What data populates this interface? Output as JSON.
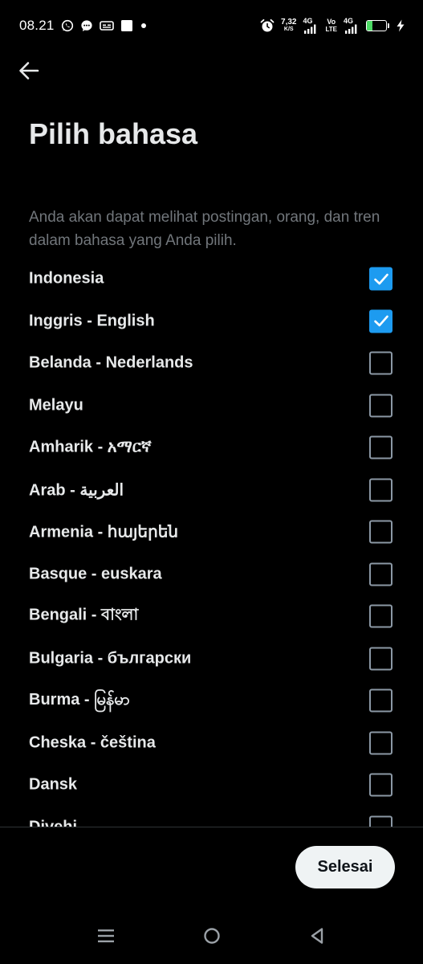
{
  "status_bar": {
    "time": "08.21",
    "net_speed_value": "7,32",
    "net_speed_unit": "K/S",
    "sim1_label": "4G",
    "volte_top": "Vo",
    "volte_bottom": "LTE",
    "sim2_label": "4G",
    "battery_level": "31",
    "left_icons": [
      "whatsapp-icon",
      "messenger-icon",
      "caption-icon",
      "square-icon",
      "dot-icon"
    ],
    "right_icons": [
      "alarm-icon",
      "signal-icon",
      "signal-icon",
      "charging-icon"
    ]
  },
  "header": {
    "back_icon": "arrow-left-icon",
    "title": "Pilih bahasa",
    "description": "Anda akan dapat melihat postingan, orang, dan tren dalam bahasa yang Anda pilih."
  },
  "languages": [
    {
      "label": "Indonesia",
      "checked": true
    },
    {
      "label": "Inggris - English",
      "checked": true
    },
    {
      "label": "Belanda - Nederlands",
      "checked": false
    },
    {
      "label": "Melayu",
      "checked": false
    },
    {
      "label": "Amharik - አማርኛ",
      "checked": false
    },
    {
      "label": "Arab - العربية",
      "checked": false
    },
    {
      "label": "Armenia - հայերեն",
      "checked": false
    },
    {
      "label": "Basque - euskara",
      "checked": false
    },
    {
      "label": "Bengali - বাংলা",
      "checked": false
    },
    {
      "label": "Bulgaria - български",
      "checked": false
    },
    {
      "label": "Burma - မြန်မာ",
      "checked": false
    },
    {
      "label": "Cheska - čeština",
      "checked": false
    },
    {
      "label": "Dansk",
      "checked": false
    },
    {
      "label": "Divehi",
      "checked": false
    }
  ],
  "footer": {
    "done_label": "Selesai"
  },
  "nav_bar": {
    "icons": [
      "menu-icon",
      "home-icon",
      "back-triangle-icon"
    ]
  },
  "colors": {
    "background": "#000000",
    "text_primary": "#e7e9ea",
    "text_secondary": "#71767b",
    "accent": "#1d9bf0",
    "button_bg": "#eff3f4"
  }
}
